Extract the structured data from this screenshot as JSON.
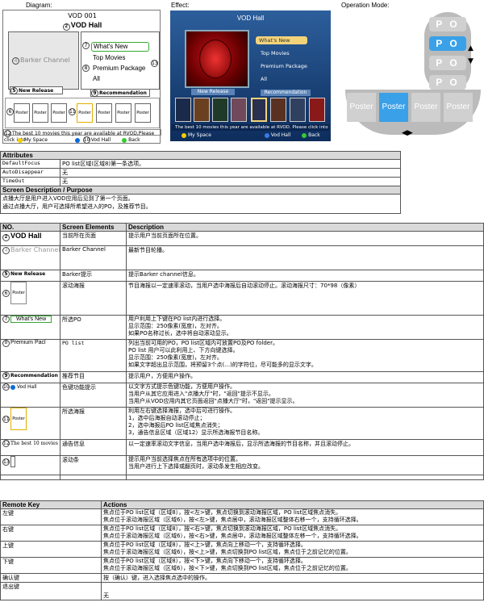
{
  "captions": {
    "diagram": "Diagram:",
    "effect": "Effect:",
    "operation": "Operation Mode:"
  },
  "diagram": {
    "title": "VOD 001",
    "hall": "VOD Hall",
    "barker": "Barker Channel",
    "po_items": [
      "What's New",
      "Top Movies",
      "Premium Package",
      "All"
    ],
    "new_release": "New Release",
    "recommendation": "Recommendation",
    "poster": "Poster",
    "info": "The best 10 movies this year are available at RVOD,Please click into",
    "my_space": "My Space",
    "vod_hall": "Vod Hall",
    "back": "Back",
    "nums": {
      "n2": "2",
      "n4": "4",
      "n5": "5",
      "n6": "6",
      "n7": "7",
      "n8": "8",
      "n9": "9",
      "n10": "10",
      "n11": "11",
      "n12": "12",
      "n13": "13"
    }
  },
  "effect": {
    "title": "VOD Hall",
    "po_items": [
      "What's New",
      "Top Movies",
      "Premium Package",
      "All"
    ],
    "new_release": "New Release",
    "recommendation": "Recommendation",
    "info": "The best 10 movies this year are available at RVOD. Please click into",
    "my_space": "My Space",
    "vod_hall": "Vod Hall",
    "back": "Back"
  },
  "operation": {
    "po": "P O",
    "poster": "Poster"
  },
  "attributes": {
    "header": "Attributes",
    "rows": [
      [
        "DefaultFocus",
        "PO list区域(区域8)第一条选项。"
      ],
      [
        "AutoDisappear",
        "无"
      ],
      [
        "TimeOut",
        "无"
      ]
    ]
  },
  "screen_desc": {
    "header": "Screen Description / Purpose",
    "lines": [
      "点播大厅是用户进入VOD应用后见到了第一个页面。",
      "通过点播大厅，用户可选择所希望进入的PO，及推荐节目。"
    ]
  },
  "elements": {
    "col_no": "NO.",
    "col_el": "Screen Elements",
    "col_desc": "Description",
    "rows": [
      {
        "no": "VOD Hall",
        "el": "当前所在页面",
        "desc": "提示用户当前页面所在位置。"
      },
      {
        "no": "Barker Channel",
        "el": "Barker Channel",
        "desc": "最新节目轮播。"
      },
      {
        "no": "New Release",
        "el": "Barker提示",
        "desc": "提示Barker channel信息。"
      },
      {
        "no": "Poster",
        "el": "滚动海报",
        "desc": "节目海报以一定速率滚动，当用户选中海报后自动滚动停止。滚动海报尺寸：70*98（像素）"
      },
      {
        "no": "What's New",
        "el": "所选PO",
        "desc": "用户利用上下键在PO list内进行选择。\n显示范围：250像素(宽度)，左对齐。\n        如果PO名称过长，选中将自动滚动显示。"
      },
      {
        "no": "Premium Pacl",
        "el": "PO list",
        "desc": "列出当前可用的PO，PO list区域内可放置PO及PO folder。\nPO list 用户可以此利用上、下方向键选择。\n显示范围：250像素(宽度)，左对齐。\n        如果文字超出显示范围，将预留3个点(…)的字符位，尽可能多的显示文字。"
      },
      {
        "no": "Recommendation",
        "el": "推荐节目",
        "desc": "提示用户，方便用户操作。"
      },
      {
        "no": "Vod Hall",
        "el": "色键功能提示",
        "desc": "以文字方式提示色键功能，方便用户操作。\n当用户从其它应用进入\"点播大厅\"时，\"返回\"提示不显示。\n当用户从VOD应用内其它页面返回\"点播大厅\"时，\"返回\"提示显示。"
      },
      {
        "no": "Poster",
        "el": "所选海报",
        "desc": "利用左右键选择海报，选中后可进行操作。\n1，选中后海报自动滚动停止；\n2，选中海报后PO list区域焦点消失；\n3，通告信息区域（区域12）显示所选海报节目名称。"
      },
      {
        "no": "The best 10 movies",
        "el": "通告信息",
        "desc": "以一定速率滚动文字信息，当用户选中海报后，显示所选海报的节目名称，并且滚动停止。"
      },
      {
        "no": "",
        "el": "滚动条",
        "desc": "提示用户当前选择焦点在所有选项中的位置。\n当用户进行上下选择或翻页时，滚动条发生相应改变。"
      }
    ],
    "nums": [
      "2",
      "4",
      "5",
      "6",
      "7",
      "8",
      "9",
      "10",
      "11",
      "12",
      "13"
    ]
  },
  "remote": {
    "col_key": "Remote Key",
    "col_act": "Actions",
    "rows": [
      {
        "key": "左键",
        "act": "焦点位于PO list区域（区域8），按<左>键，焦点切换到滚动海报区域，PO list区域焦点消失。\n焦点位于滚动海报区域（区域6），按<左>键，焦点居中，滚动海报区域整体右移一个，支持循环选择。"
      },
      {
        "key": "右键",
        "act": "焦点位于PO list区域（区域8），按<右>键，焦点切换到滚动海报区域，PO list区域焦点消失。\n焦点位于滚动海报区域（区域6），按<右>键，焦点居中，滚动海报区域整体左移一个，支持循环选择。"
      },
      {
        "key": "上键",
        "act": "焦点位于PO list区域（区域8），按<上>键，焦点向上移动一个，支持循环选择。\n焦点位于滚动海报区域（区域6），按<上>键，焦点切换到PO list区域，焦点位于之前记忆的位置。"
      },
      {
        "key": "下键",
        "act": "焦点位于PO list区域（区域8），按<下>键，焦点向下移动一个，支持循环选择。\n焦点位于滚动海报区域（区域6），按<下>键，焦点切换到PO list区域，焦点位于之前记忆的位置。"
      },
      {
        "key": "确认键",
        "act": "按（确认）键，进入选择焦点选中的操作。"
      },
      {
        "key": "退出键",
        "act": "无"
      }
    ]
  }
}
